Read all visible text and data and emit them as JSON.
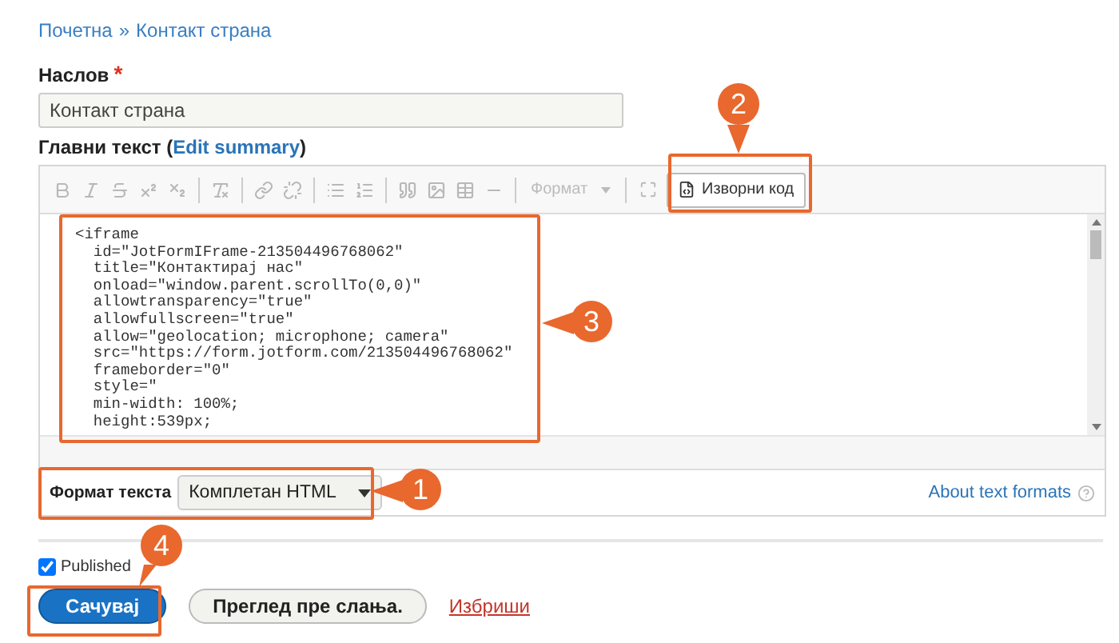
{
  "breadcrumb": [
    {
      "label": "Почетна"
    },
    {
      "label": "Контакт страна"
    }
  ],
  "breadcrumb_separator": "»",
  "title_field": {
    "label": "Наслов",
    "required_mark": "*",
    "value": "Контакт страна"
  },
  "body_field": {
    "label": "Главни текст",
    "summary_open": "(",
    "summary_link": "Edit summary",
    "summary_close": ")"
  },
  "toolbar": {
    "tools": [
      {
        "disabled": true
      },
      {
        "disabled": true
      },
      {
        "disabled": true
      },
      {
        "disabled": true
      },
      {
        "disabled": true
      },
      {
        "disabled": true
      },
      {
        "disabled": true
      },
      {
        "disabled": true
      },
      {
        "disabled": true
      },
      {
        "disabled": true
      },
      {
        "disabled": true
      },
      {
        "disabled": true
      },
      {
        "disabled": true
      },
      {
        "disabled": true
      }
    ],
    "format_dropdown": {
      "label": "Формат",
      "disabled": true
    },
    "maximize": {
      "disabled": true
    },
    "source_button": {
      "label": "Изворни код",
      "disabled": false
    }
  },
  "code_lines": [
    "<iframe",
    "  id=\"JotFormIFrame-213504496768062\"",
    "  title=\"Контактирај нас\"",
    "  onload=\"window.parent.scrollTo(0,0)\"",
    "  allowtransparency=\"true\"",
    "  allowfullscreen=\"true\"",
    "  allow=\"geolocation; microphone; camera\"",
    "  src=\"https://form.jotform.com/213504496768062\"",
    "  frameborder=\"0\"",
    "  style=\"",
    "  min-width: 100%;",
    "  height:539px;"
  ],
  "text_format": {
    "label": "Формат текста",
    "value": "Комплетан HTML",
    "about_link": "About text formats"
  },
  "published": {
    "label": "Published",
    "checked": true
  },
  "actions": {
    "save": "Сачувај",
    "preview": "Преглед пре слања.",
    "delete": "Избриши"
  },
  "annotations": [
    {
      "label": "1"
    },
    {
      "label": "2"
    },
    {
      "label": "3"
    },
    {
      "label": "4"
    }
  ]
}
